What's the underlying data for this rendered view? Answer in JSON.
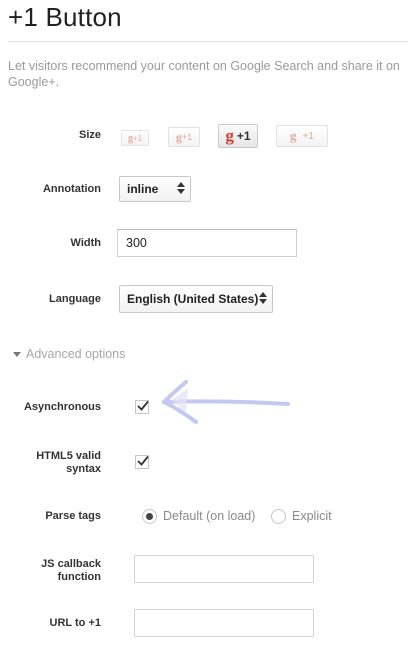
{
  "page": {
    "title": "+1 Button",
    "intro": "Let visitors recommend your content on Google Search and share it on Google+."
  },
  "size": {
    "label": "Size",
    "options": [
      {
        "g": "g",
        "text": "+1"
      },
      {
        "g": "g",
        "text": "+1"
      },
      {
        "g": "g",
        "text": "+1",
        "selected": true
      },
      {
        "g": "g",
        "text": "+1"
      }
    ]
  },
  "annotation": {
    "label": "Annotation",
    "value": "inline"
  },
  "width": {
    "label": "Width",
    "value": "300"
  },
  "language": {
    "label": "Language",
    "value": "English (United States)"
  },
  "advanced": {
    "toggle_label": "Advanced options"
  },
  "asynchronous": {
    "label": "Asynchronous",
    "checked": true
  },
  "html5": {
    "label_line1": "HTML5 valid",
    "label_line2": "syntax",
    "checked": true
  },
  "parse_tags": {
    "label": "Parse tags",
    "options": [
      "Default (on load)",
      "Explicit"
    ],
    "selected": "Default (on load)"
  },
  "js_callback": {
    "label_line1": "JS callback",
    "label_line2": "function",
    "value": ""
  },
  "url": {
    "label": "URL to +1",
    "value": ""
  },
  "colors": {
    "accent_red": "#d23f31",
    "annotation_arrow": "#c3c8f0",
    "muted_text": "#9a9a9a"
  }
}
